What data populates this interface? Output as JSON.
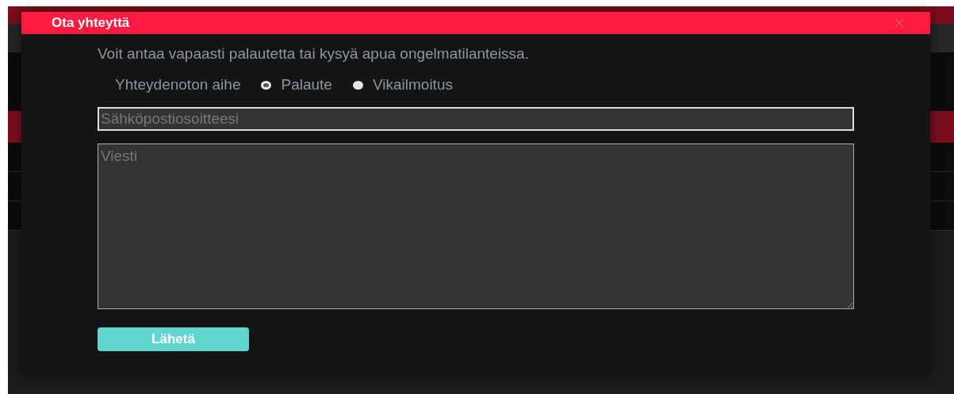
{
  "dialog": {
    "title": "Ota yhteyttä",
    "description": "Voit antaa vapaasti palautetta tai kysyä apua ongelmatilanteissa.",
    "topic": {
      "label": "Yhteydenoton aihe",
      "options": [
        {
          "label": "Palaute",
          "selected": true
        },
        {
          "label": "Vikailmoitus",
          "selected": false
        }
      ]
    },
    "email": {
      "placeholder": "Sähköpostiosoitteesi"
    },
    "message": {
      "placeholder": "Viesti"
    },
    "submit": "Lähetä"
  }
}
